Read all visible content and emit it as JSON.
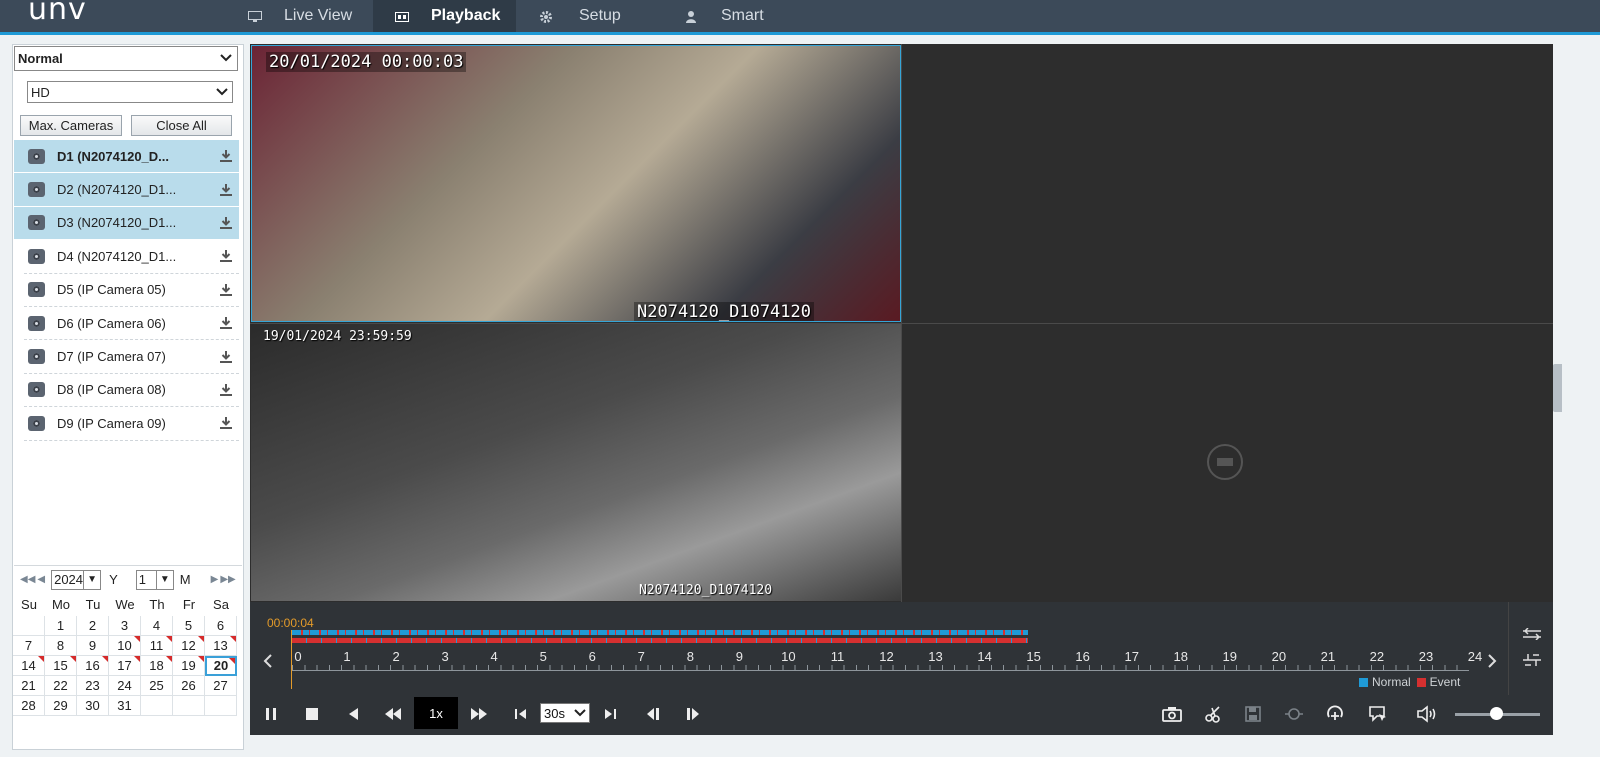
{
  "header": {
    "logo": "unv",
    "nav": [
      {
        "label": "Live View",
        "icon": "monitor-icon"
      },
      {
        "label": "Playback",
        "icon": "playback-icon",
        "active": true
      },
      {
        "label": "Setup",
        "icon": "gear-icon"
      },
      {
        "label": "Smart",
        "icon": "user-icon"
      }
    ]
  },
  "sidebar": {
    "stream_mode": "Normal",
    "quality": "HD",
    "max_cameras_label": "Max. Cameras",
    "close_all_label": "Close All",
    "cameras": [
      {
        "label": "D1 (N2074120_D...",
        "selected": true,
        "bold": true
      },
      {
        "label": "D2 (N2074120_D1...",
        "selected": true
      },
      {
        "label": "D3 (N2074120_D1...",
        "selected": true
      },
      {
        "label": "D4 (N2074120_D1..."
      },
      {
        "label": "D5 (IP Camera 05)"
      },
      {
        "label": "D6 (IP Camera 06)"
      },
      {
        "label": "D7 (IP Camera 07)"
      },
      {
        "label": "D8 (IP Camera 08)"
      },
      {
        "label": "D9 (IP Camera 09)"
      }
    ]
  },
  "calendar": {
    "year": "2024",
    "year_unit": "Y",
    "month": "1",
    "month_unit": "M",
    "weekdays": [
      "Su",
      "Mo",
      "Tu",
      "We",
      "Th",
      "Fr",
      "Sa"
    ],
    "weeks": [
      [
        "",
        "1",
        "2",
        "3",
        "4",
        "5",
        "6"
      ],
      [
        "7",
        "8",
        "9",
        "10",
        "11",
        "12",
        "13"
      ],
      [
        "14",
        "15",
        "16",
        "17",
        "18",
        "19",
        "20"
      ],
      [
        "21",
        "22",
        "23",
        "24",
        "25",
        "26",
        "27"
      ],
      [
        "28",
        "29",
        "30",
        "31",
        "",
        "",
        ""
      ]
    ],
    "recorded_days": [
      "10",
      "11",
      "12",
      "13",
      "14",
      "15",
      "16",
      "17",
      "18",
      "19",
      "20"
    ],
    "today": "20"
  },
  "video": {
    "tile1_timestamp": "20/01/2024 00:00:03",
    "tile1_name": "N2074120_D1074120",
    "tile3_timestamp": "19/01/2024 23:59:59",
    "tile3_name": "N2074120_D1074120"
  },
  "timeline": {
    "current_time": "00:00:04",
    "hours": [
      "0",
      "1",
      "2",
      "3",
      "4",
      "5",
      "6",
      "7",
      "8",
      "9",
      "10",
      "11",
      "12",
      "13",
      "14",
      "15",
      "16",
      "17",
      "18",
      "19",
      "20",
      "21",
      "22",
      "23",
      "24"
    ],
    "recording_end_hour": 15,
    "legend_normal": "Normal",
    "legend_event": "Event",
    "colors": {
      "normal": "#1f9ad6",
      "event": "#d53030"
    }
  },
  "controls": {
    "speed": "1x",
    "interval": "30s"
  }
}
